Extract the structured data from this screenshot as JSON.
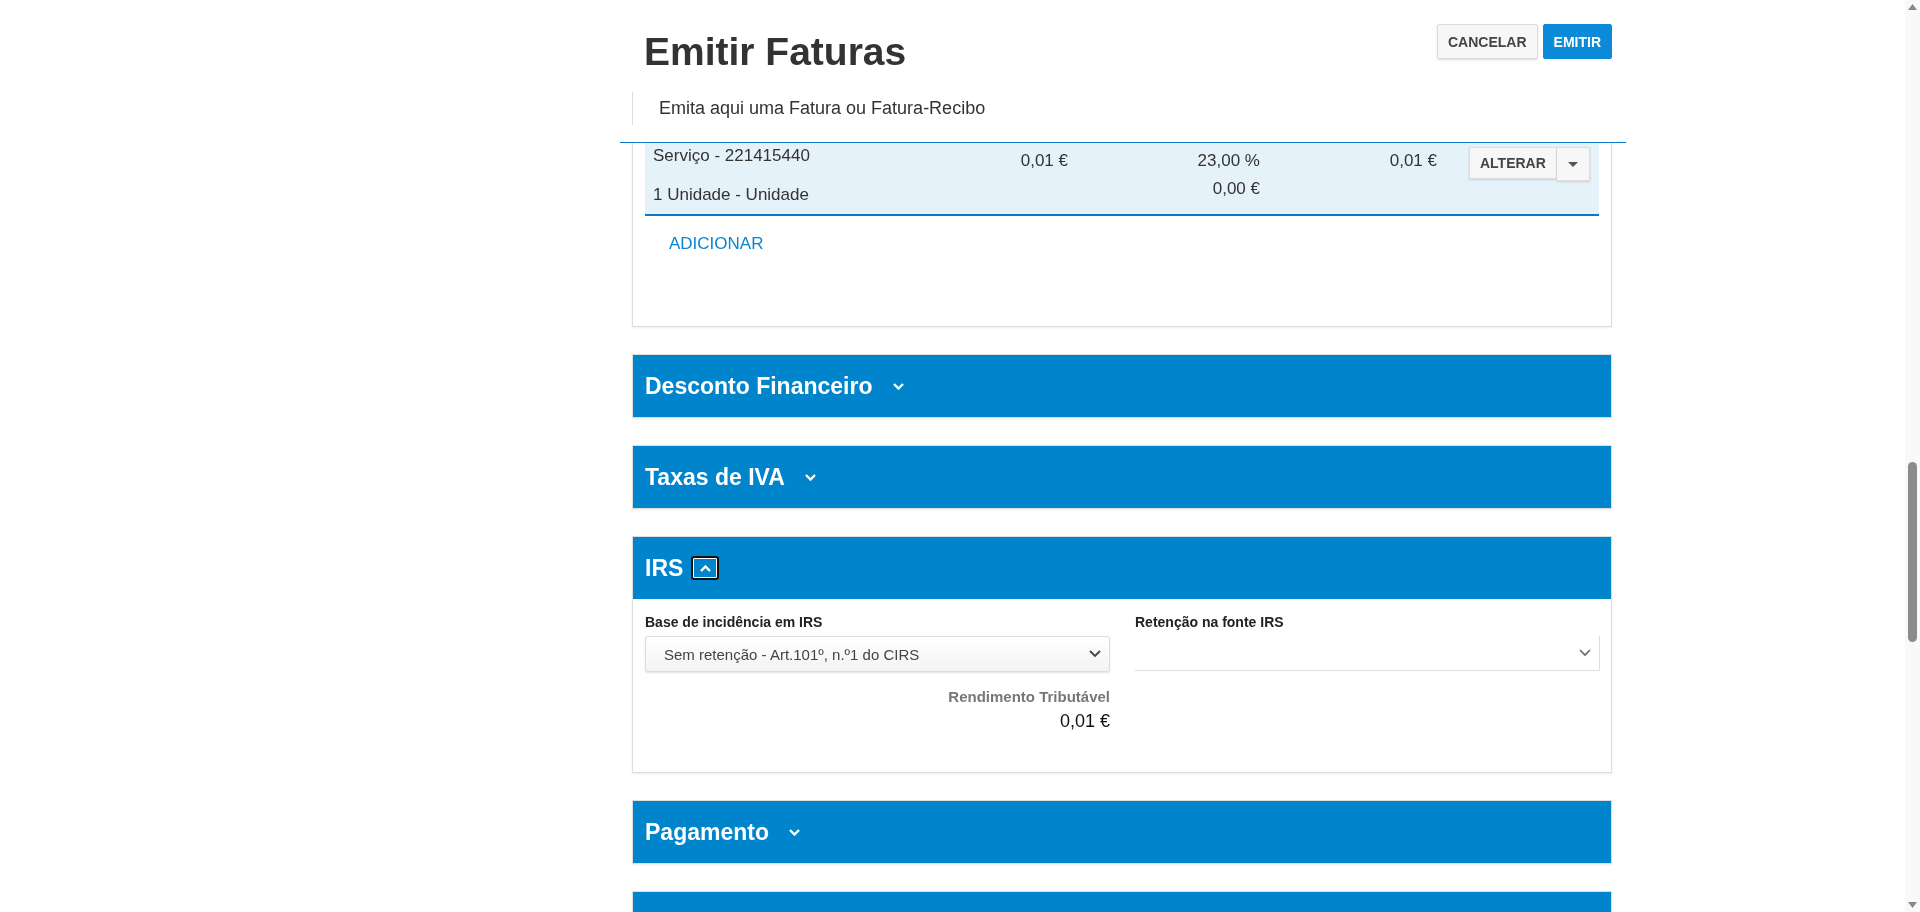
{
  "page": {
    "title": "Emitir Faturas",
    "subtitle": "Emita aqui uma Fatura ou Fatura-Recibo",
    "actions": [
      {
        "label": "CANCELAR",
        "kind": "secondary"
      },
      {
        "label": "EMITIR",
        "kind": "primary"
      }
    ]
  },
  "items": {
    "rows": [
      {
        "description": "Serviço - 221415440",
        "quantity": "1 Unidade - Unidade",
        "price": "0,01 €",
        "tax_rate": "23,00 %",
        "tax_amount": "0,00 €",
        "total": "0,01 €",
        "action": "ALTERAR",
        "selected": true
      }
    ],
    "add_link": "ADICIONAR"
  },
  "sections": [
    {
      "title": "Desconto Financeiro",
      "expanded": false
    },
    {
      "title": "Taxas de IVA",
      "expanded": false
    },
    {
      "title": "IRS",
      "expanded": true,
      "body": {
        "base_label": "Base de incidência em IRS",
        "base_value": "Sem retenção - Art.101º, n.º1 do CIRS",
        "retention_label": "Retenção na fonte IRS",
        "taxable_label": "Rendimento Tributável",
        "taxable_value": "0,01 €"
      }
    },
    {
      "title": "Pagamento",
      "expanded": false
    },
    {
      "expanded": false
    }
  ]
}
